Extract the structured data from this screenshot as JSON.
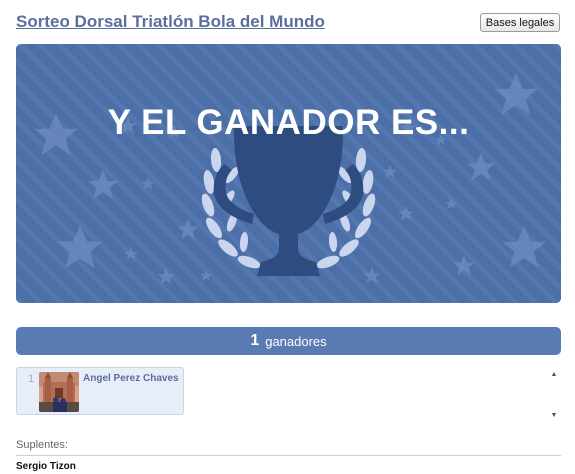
{
  "header": {
    "title": "Sorteo Dorsal Triatlón Bola del Mundo",
    "legal_button": "Bases legales"
  },
  "banner": {
    "heading": "Y EL GANADOR ES...",
    "image": "trophy-with-laurel-wreath",
    "colors": {
      "background": "#4c6fa8",
      "trophy": "#2f4c80",
      "laurel": "#c9d6ee",
      "stars": "#7592c4"
    }
  },
  "winners": {
    "count": "1",
    "label": "ganadores",
    "list": [
      {
        "rank": "1",
        "name": "Angel Perez Chaves",
        "photo": "cathedral-photo"
      }
    ]
  },
  "substitutes": {
    "label": "Suplentes:",
    "names": [
      "Sergio Tizon"
    ]
  }
}
